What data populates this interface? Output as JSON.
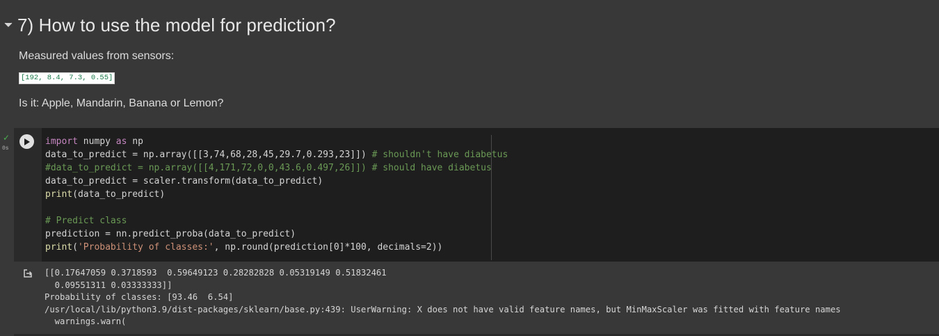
{
  "section": {
    "title": "7) How to use the model for prediction?",
    "collapse_icon": "caret-down-icon"
  },
  "markdown": {
    "paragraph1": "Measured values from sensors:",
    "inline_code": "[192, 8.4, 7.3, 0.55]",
    "paragraph2": "Is it: Apple, Mandarin, Banana or Lemon?"
  },
  "cell": {
    "exec_status": "✓",
    "exec_time": "0s",
    "run_icon": "play-icon",
    "code_lines": [
      {
        "parts": [
          {
            "t": "import",
            "c": "kw"
          },
          {
            "t": " numpy ",
            "c": ""
          },
          {
            "t": "as",
            "c": "kw"
          },
          {
            "t": " np",
            "c": ""
          }
        ]
      },
      {
        "parts": [
          {
            "t": "data_to_predict = np.array([[3,74,68,28,45,29.7,0.293,23]]) ",
            "c": ""
          },
          {
            "t": "# shouldn't have diabetus",
            "c": "cm"
          }
        ]
      },
      {
        "parts": [
          {
            "t": "#data_to_predict = np.array([[4,171,72,0,0,43.6,0.497,26]]) # should have diabetus",
            "c": "cm"
          }
        ]
      },
      {
        "parts": [
          {
            "t": "data_to_predict = scaler.transform(data_to_predict)",
            "c": ""
          }
        ]
      },
      {
        "parts": [
          {
            "t": "print",
            "c": "fn"
          },
          {
            "t": "(data_to_predict)",
            "c": ""
          }
        ]
      },
      {
        "parts": [
          {
            "t": "",
            "c": ""
          }
        ]
      },
      {
        "parts": [
          {
            "t": "# Predict class",
            "c": "cm"
          }
        ]
      },
      {
        "parts": [
          {
            "t": "prediction = nn.predict_proba(data_to_predict)",
            "c": ""
          }
        ]
      },
      {
        "parts": [
          {
            "t": "print",
            "c": "fn"
          },
          {
            "t": "(",
            "c": ""
          },
          {
            "t": "'Probability of classes:'",
            "c": "str"
          },
          {
            "t": ", np.round(prediction[0]*100, decimals=2))",
            "c": ""
          }
        ]
      }
    ]
  },
  "output": {
    "icon": "output-arrow-icon",
    "lines": [
      "[[0.17647059 0.3718593  0.59649123 0.28282828 0.05319149 0.51832461",
      "  0.09551311 0.03333333]]",
      "Probability of classes: [93.46  6.54]",
      "/usr/local/lib/python3.9/dist-packages/sklearn/base.py:439: UserWarning: X does not have valid feature names, but MinMaxScaler was fitted with feature names",
      "  warnings.warn("
    ]
  },
  "colors": {
    "background": "#383838",
    "code_background": "#1e1e1e",
    "check": "#4caf50"
  }
}
